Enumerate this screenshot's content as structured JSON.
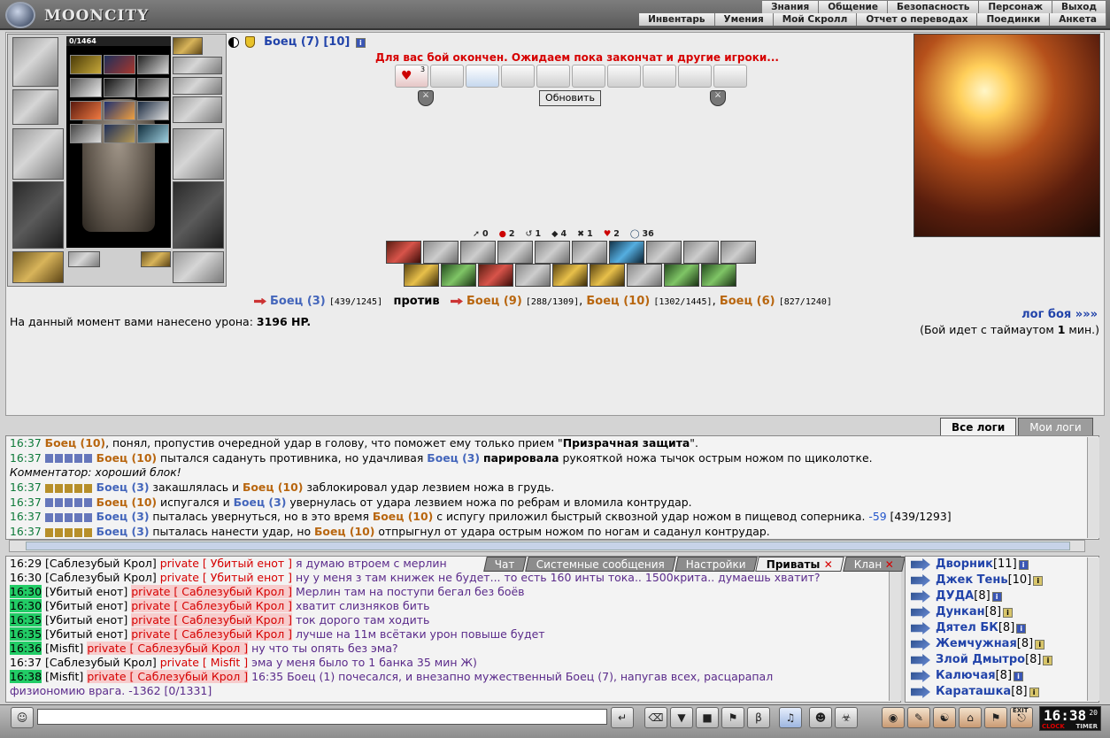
{
  "app": {
    "title": "MOONCITY"
  },
  "top_menu": {
    "row1": [
      "Знания",
      "Общение",
      "Безопасность",
      "Персонаж",
      "Выход"
    ],
    "row2": [
      "Инвентарь",
      "Умения",
      "Мой Скролл",
      "Отчет о переводах",
      "Поединки",
      "Анкета"
    ]
  },
  "player": {
    "hp": "0/1464"
  },
  "enemy": {
    "name": "Боец (7)",
    "level": "[10]"
  },
  "battle": {
    "message": "Для вас бой окончен. Ожидаем пока закончат и другие игроки...",
    "refresh_label": "Обновить",
    "scroll_count": "3",
    "stats": [
      "0",
      "2",
      "1",
      "4",
      "1",
      "2",
      "36"
    ],
    "versus": {
      "left_name": "Боец (3)",
      "left_hp": "[439/1245]",
      "vs": "против",
      "right": [
        {
          "name": "Боец (9)",
          "hp": "[288/1309]"
        },
        {
          "name": "Боец (10)",
          "hp": "[1302/1445]"
        },
        {
          "name": "Боец (6)",
          "hp": "[827/1240]"
        }
      ]
    },
    "damage_label": "На данный момент вами нанесено урона:",
    "damage_value": "3196 HP.",
    "log_link": "лог боя »»»",
    "timeout_text_a": "(Бой идет с таймаутом",
    "timeout_value": "1",
    "timeout_text_b": "мин.)"
  },
  "log_tabs": [
    "Все логи",
    "Мои логи"
  ],
  "log": [
    {
      "time": "16:37",
      "a": "Боец (10)",
      "text1": ", понял, пропустив очередной удар в голову, что поможет ему только прием \"",
      "bold": "Призрачная защита",
      "text2": "\"."
    },
    {
      "time": "16:37",
      "a": "Боец (10)",
      "text1": " пытался садануть противника, но удачливая ",
      "b": "Боец (3)",
      "bold": "парировала",
      "text2": " рукояткой ножа тычок острым ножом по щиколотке."
    },
    {
      "comment": "Комментатор: хороший блок!"
    },
    {
      "time": "16:37",
      "a": "Боец (3)",
      "text1": " закашлялась и ",
      "b": "Боец (10)",
      "text2": " заблокировал удар лезвием ножа в грудь."
    },
    {
      "time": "16:37",
      "a": "Боец (10)",
      "text1": " испугался и ",
      "b": "Боец (3)",
      "text2": " увернулась от удара лезвием ножа по ребрам и вломила контрудар."
    },
    {
      "time": "16:37",
      "a": "Боец (3)",
      "text1": " пыталась увернуться, но в это время ",
      "b": "Боец (10)",
      "text2": " с испугу приложил быстрый сквозной удар ножом в пищевод соперника. ",
      "neg": "-59",
      "hp": " [439/1293]"
    },
    {
      "time": "16:37",
      "a": "Боец (3)",
      "text1": " пыталась нанести удар, но ",
      "b": "Боец (10)",
      "text2": " отпрыгнул от удара острым ножом по ногам и саданул контрудар."
    }
  ],
  "chat_tabs": [
    "Чат",
    "Системные сообщения",
    "Настройки",
    "Приваты",
    "Клан"
  ],
  "chat": [
    {
      "time": "16:29",
      "hl": false,
      "from": "[Саблезубый Крол]",
      "to": "private [ Убитый енот ]",
      "msg": "я думаю втроем с мерлин"
    },
    {
      "time": "16:30",
      "hl": false,
      "from": "[Саблезубый Крол]",
      "to": "private [ Убитый енот ]",
      "msg": "ну у меня з там книжек не будет... то есть 160 инты тока.. 1500крита.. думаешь хватит?"
    },
    {
      "time": "16:30",
      "hl": true,
      "from": "[Убитый енот]",
      "to": "private [ Саблезубый Крол ]",
      "msg": "Мерлин там на поступи бегал без боёв"
    },
    {
      "time": "16:30",
      "hl": true,
      "from": "[Убитый енот]",
      "to": "private [ Саблезубый Крол ]",
      "msg": "хватит слизняков бить"
    },
    {
      "time": "16:35",
      "hl": true,
      "from": "[Убитый енот]",
      "to": "private [ Саблезубый Крол ]",
      "msg": "ток дорого там ходить"
    },
    {
      "time": "16:35",
      "hl": true,
      "from": "[Убитый енот]",
      "to": "private [ Саблезубый Крол ]",
      "msg": "лучше на 11м всётаки урон повыше будет"
    },
    {
      "time": "16:36",
      "hl": true,
      "from": "[Misfit]",
      "to": "private [ Саблезубый Крол ]",
      "msg": "ну что ты опять без эма?"
    },
    {
      "time": "16:37",
      "hl": false,
      "from": "[Саблезубый Крол]",
      "to": "private [ Misfit ]",
      "msg": "эма у меня было то 1 банка 35 мин Ж)"
    },
    {
      "time": "16:38",
      "hl": true,
      "from": "[Misfit]",
      "to": "private [ Саблезубый Крол ]",
      "msg": "16:35 Боец (1) почесался, и внезапно мужественный Боец (7), напугав всех, расцарапал"
    },
    {
      "cont": "физиономию врага. -1362 [0/1331]"
    }
  ],
  "online": [
    {
      "name": "Дворник",
      "level": "[11]",
      "info": "b"
    },
    {
      "name": "Джек Тень",
      "level": "[10]",
      "info": "y"
    },
    {
      "name": "ДУДА",
      "level": "[8]",
      "info": "b"
    },
    {
      "name": "Дункан",
      "level": "[8]",
      "info": "y"
    },
    {
      "name": "Дятел БК",
      "level": "[8]",
      "info": "b"
    },
    {
      "name": "Жемчужная",
      "level": "[8]",
      "info": "y"
    },
    {
      "name": "Злой Дмытро",
      "level": "[8]",
      "info": "y"
    },
    {
      "name": "Калючая",
      "level": "[8]",
      "info": "b"
    },
    {
      "name": "Караташка",
      "level": "[8]",
      "info": "y"
    }
  ],
  "clock": {
    "time": "16:38",
    "seconds": "20",
    "label_clock": "CLOCK",
    "label_timer": "TIMER",
    "exit": "EXIT"
  },
  "colors": {
    "accent": "#2244aa",
    "alert": "#d60000",
    "time_highlight": "#22cc66"
  }
}
